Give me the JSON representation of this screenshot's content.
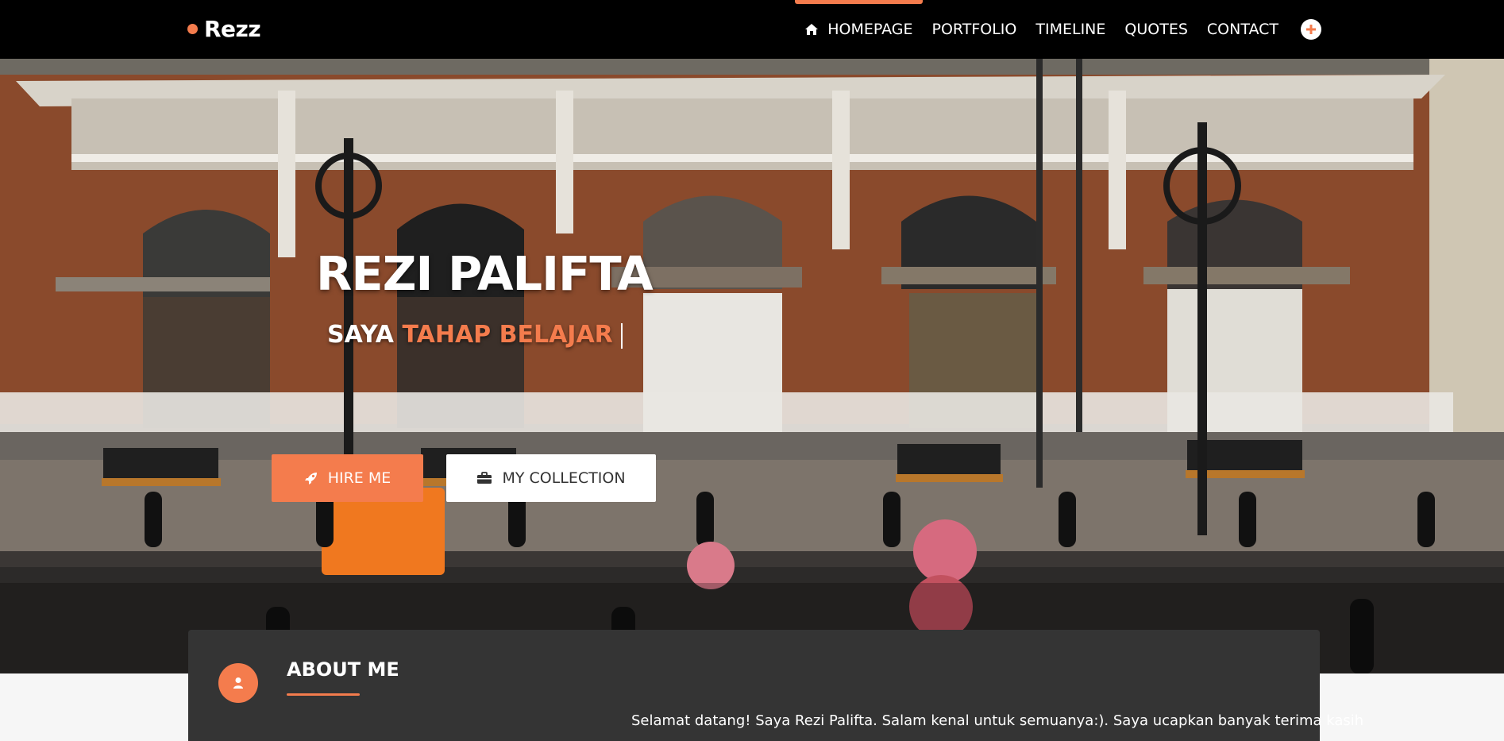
{
  "brand": {
    "name": "Rezz"
  },
  "nav": {
    "items": [
      {
        "label": "HOMEPAGE",
        "icon": "home-icon",
        "active": true
      },
      {
        "label": "PORTFOLIO"
      },
      {
        "label": "TIMELINE"
      },
      {
        "label": "QUOTES"
      },
      {
        "label": "CONTACT"
      }
    ],
    "extra_icon": "plus-circle-icon"
  },
  "hero": {
    "name": "REZI PALIFTA",
    "tagline_static": "SAYA",
    "tagline_typed": "TAHAP BELAJAR",
    "buttons": {
      "hire": {
        "label": "HIRE ME",
        "icon": "rocket-icon"
      },
      "collection": {
        "label": "MY COLLECTION",
        "icon": "briefcase-icon"
      }
    }
  },
  "about": {
    "icon": "user-icon",
    "title": "ABOUT ME",
    "text": "Selamat datang! Saya Rezi Palifta. Salam kenal untuk semuanya:). Saya ucapkan banyak terima kasih"
  },
  "colors": {
    "accent": "#f47c4d",
    "navbar": "#000000",
    "card": "#343434",
    "page_bg": "#f6f6f6"
  }
}
